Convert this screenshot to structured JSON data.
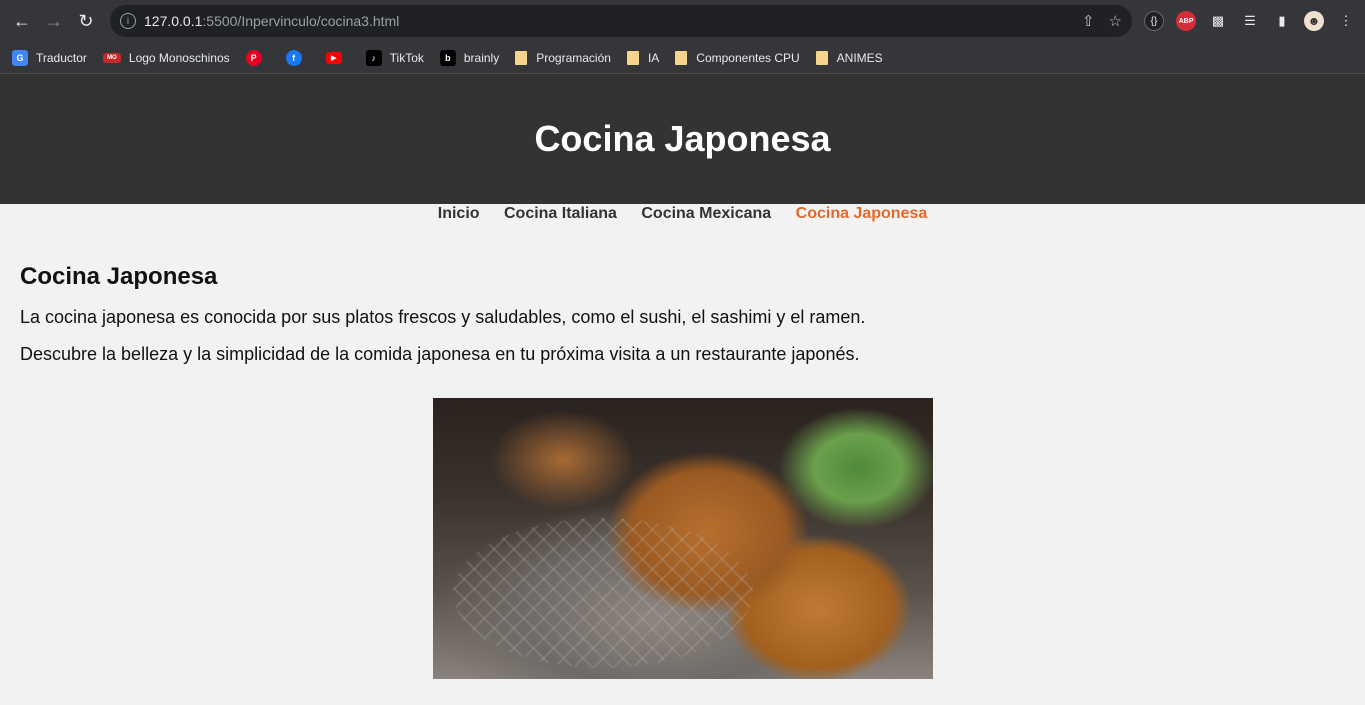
{
  "browser": {
    "url_host": "127.0.0.1",
    "url_path": ":5500/Inpervinculo/cocina3.html",
    "bookmarks": [
      {
        "label": "Traductor",
        "icon": "google-translate-icon",
        "color": "#4285f4"
      },
      {
        "label": "Logo Monoschinos",
        "icon": "monoschinos-icon",
        "color": "#c62828"
      },
      {
        "label": "",
        "icon": "pinterest-icon",
        "color": "#e60023"
      },
      {
        "label": "",
        "icon": "facebook-icon",
        "color": "#1877f2"
      },
      {
        "label": "",
        "icon": "youtube-icon",
        "color": "#ff0000"
      },
      {
        "label": "TikTok",
        "icon": "tiktok-icon",
        "color": "#000000"
      },
      {
        "label": "brainly",
        "icon": "brainly-icon",
        "color": "#000000"
      },
      {
        "label": "Programación",
        "icon": "folder-icon",
        "color": "#f5d58a"
      },
      {
        "label": "IA",
        "icon": "folder-icon",
        "color": "#f5d58a"
      },
      {
        "label": "Componentes CPU",
        "icon": "folder-icon",
        "color": "#f5d58a"
      },
      {
        "label": "ANIMES",
        "icon": "folder-icon",
        "color": "#f5d58a"
      }
    ]
  },
  "site": {
    "header_title": "Cocina Japonesa",
    "nav": [
      {
        "label": "Inicio",
        "active": false
      },
      {
        "label": "Cocina Italiana",
        "active": false
      },
      {
        "label": "Cocina Mexicana",
        "active": false
      },
      {
        "label": "Cocina Japonesa",
        "active": true
      }
    ],
    "heading": "Cocina Japonesa",
    "paragraphs": [
      "La cocina japonesa es conocida por sus platos frescos y saludables, como el sushi, el sashimi y el ramen.",
      "Descubre la belleza y la simplicidad de la comida japonesa en tu próxima visita a un restaurante japonés."
    ],
    "accent_color": "#e26a2c"
  }
}
